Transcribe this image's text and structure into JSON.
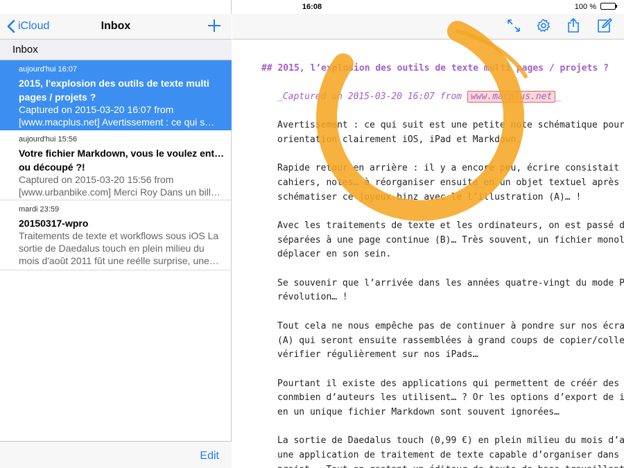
{
  "status_bar": {
    "device": "iPad",
    "time": "16:08",
    "battery": "100 %"
  },
  "sidebar": {
    "back_label": "iCloud",
    "title": "Inbox",
    "section_header": "Inbox",
    "edit_label": "Edit",
    "items": [
      {
        "time": "aujourd'hui 16:07",
        "title_lines": [
          "2015, l'explosion des outils de texte multi",
          "pages / projets ?"
        ],
        "snippet_lines": [
          "Captured on 2015-03-20 16:07 from",
          "[www.macplus.net] Avertissement : ce qui s…"
        ],
        "selected": true
      },
      {
        "time": "aujourd'hui 15:56",
        "title_lines": [
          "Votre fichier Markdown, vous le voulez entier",
          "ou découpé ?!"
        ],
        "snippet_lines": [
          "Captured on 2015-03-20 15:56 from",
          "[www.urbanbike.com] Merci Roy Dans un bill…"
        ],
        "selected": false
      },
      {
        "time": "mardi 23:59",
        "title_lines": [
          "20150317-wpro"
        ],
        "snippet_lines": [
          "Traitements de texte et workflows sous iOS La",
          "sortie de Daedalus touch en plein milieu du",
          "mois d'août 2011 fût une reélle surprise, une…"
        ],
        "selected": false
      }
    ]
  },
  "editor": {
    "heading": "## 2015, l’explosion des outils de texte multi pages / projets ?",
    "captured_prefix": "_Captured on 2015-03-20 16:07 from ",
    "captured_link": "www.macplus.net",
    "captured_suffix": "_",
    "lines": [
      "Avertissement : ce qui suit est une petite note schématique pour",
      "orientation clairement iOS, iPad et Markdown.",
      "",
      "Rapide retour en arrière : il y a encore peu, écrire consistait à",
      "cahiers, notes… à réorganiser ensuite en un objet textuel après m",
      "schématiser ce joyeux binz avec le l’illustration (A)… !",
      "",
      "Avec les traitements de texte et les ordinateurs, on est passé d’",
      "séparées à une page continue (B)… Très souvent, un fichier monoli",
      "déplacer en son sein.",
      "",
      "Se souvenir que l’arrivée dans les années quatre-vingt du mode Pl",
      "révolution… !",
      "",
      "Tout cela ne nous empêche pas de continuer à pondre sur nos écran",
      "(A) qui seront ensuite rassemblées à grand coups de copier/coller",
      "vérifier régulièrement sur nos iPads…",
      "",
      "Pourtant il existe des applications qui permettent de créér des c",
      "conmbien d’auteurs les utilisent… ? Or les options d’export de iT",
      "en un unique fichier Markdown sont souvent ignorées…",
      "",
      "La sortie de Daedalus touch (0,99 €) en plein milieu du mois d’ao",
      "une application de traitement de texte capable d’organiser dans u",
      "projet…. Tout en restant un éditeur de texte de base travaillant"
    ]
  },
  "icons": [
    "expand-icon",
    "gear-icon",
    "share-icon",
    "compose-icon",
    "plus-icon",
    "chevron-left-icon",
    "wifi-icon",
    "battery-icon"
  ],
  "colors": {
    "accent": "#1a7ef2",
    "selection": "#3c8ff0",
    "heading": "#a45ec8",
    "overlay_ring": "#f5a623"
  }
}
